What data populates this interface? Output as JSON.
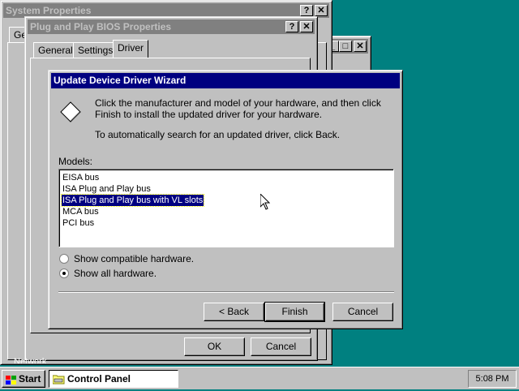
{
  "system_properties": {
    "title": "System Properties",
    "help": "?",
    "close": "✕",
    "tab_partial": "Ge"
  },
  "bios_properties": {
    "title": "Plug and Play BIOS Properties",
    "help": "?",
    "close": "✕",
    "tabs": [
      "General",
      "Settings",
      "Driver"
    ],
    "ok_label": "OK",
    "cancel_label": "Cancel"
  },
  "background_window": {
    "minimize": "_",
    "maximize": "□",
    "close": "✕"
  },
  "wizard": {
    "title": "Update Device Driver Wizard",
    "instruction": "Click the manufacturer and model of your hardware, and then click Finish to install the updated driver for your hardware.",
    "auto_search": "To automatically search for an updated driver, click Back.",
    "models_label": "Models:",
    "models": [
      "EISA bus",
      "ISA Plug and Play bus",
      "ISA Plug and Play bus with VL slots",
      "MCA bus",
      "PCI bus"
    ],
    "selected_model": "ISA Plug and Play bus with VL slots",
    "radio_compatible": "Show compatible hardware.",
    "radio_all": "Show all hardware.",
    "selected_radio": "all",
    "back_label": "< Back",
    "finish_label": "Finish",
    "cancel_label": "Cancel"
  },
  "taskbar": {
    "start_label": "Start",
    "task_label": "Control Panel",
    "clock": "5:08 PM",
    "partial_label": "Network"
  }
}
